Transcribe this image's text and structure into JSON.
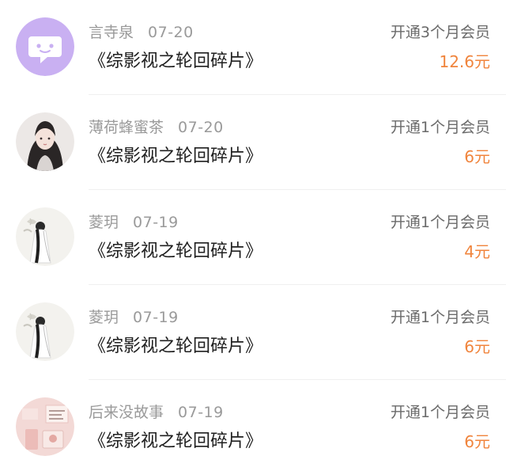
{
  "records": [
    {
      "name": "言寺泉",
      "date": "07-20",
      "title": "《综影视之轮回碎片》",
      "plan": "开通3个月会员",
      "amount": "12.6元",
      "avatar_icon": "chat-bubble-face-icon"
    },
    {
      "name": "薄荷蜂蜜茶",
      "date": "07-20",
      "title": "《综影视之轮回碎片》",
      "plan": "开通1个月会员",
      "amount": "6元",
      "avatar_icon": "illustrated-girl-avatar"
    },
    {
      "name": "菱玥",
      "date": "07-19",
      "title": "《综影视之轮回碎片》",
      "plan": "开通1个月会员",
      "amount": "4元",
      "avatar_icon": "ink-figure-avatar"
    },
    {
      "name": "菱玥",
      "date": "07-19",
      "title": "《综影视之轮回碎片》",
      "plan": "开通1个月会员",
      "amount": "6元",
      "avatar_icon": "ink-figure-avatar"
    },
    {
      "name": "后来没故事",
      "date": "07-19",
      "title": "《综影视之轮回碎片》",
      "plan": "开通1个月会员",
      "amount": "6元",
      "avatar_icon": "pink-photo-avatar"
    }
  ],
  "colors": {
    "amount": "#f0843c",
    "meta": "#9a9a9a",
    "title": "#1f1f1f",
    "avatar_purple": "#c9b0f2"
  }
}
